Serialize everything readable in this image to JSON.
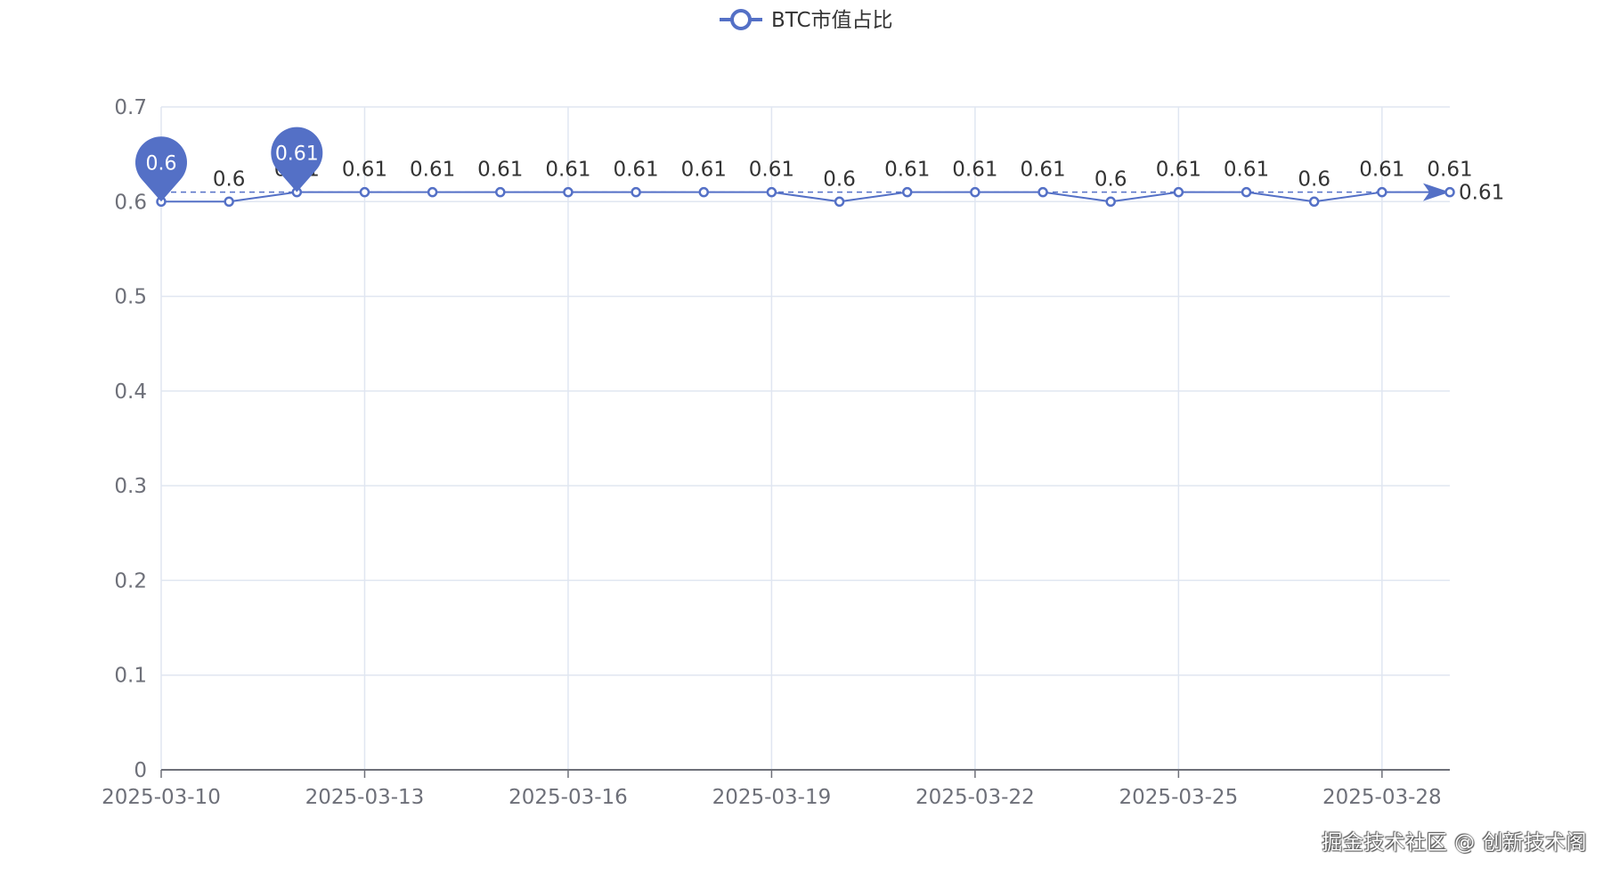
{
  "chart_data": {
    "type": "line",
    "legend": {
      "label": "BTC市值占比",
      "position": "top-center"
    },
    "x": [
      "2025-03-10",
      "2025-03-11",
      "2025-03-12",
      "2025-03-13",
      "2025-03-14",
      "2025-03-15",
      "2025-03-16",
      "2025-03-17",
      "2025-03-18",
      "2025-03-19",
      "2025-03-20",
      "2025-03-21",
      "2025-03-22",
      "2025-03-23",
      "2025-03-24",
      "2025-03-25",
      "2025-03-26",
      "2025-03-27",
      "2025-03-28",
      "2025-03-29"
    ],
    "x_tick_labels": [
      "2025-03-10",
      "2025-03-13",
      "2025-03-16",
      "2025-03-19",
      "2025-03-22",
      "2025-03-25",
      "2025-03-28"
    ],
    "series": [
      {
        "name": "BTC市值占比",
        "values": [
          0.6,
          0.6,
          0.61,
          0.61,
          0.61,
          0.61,
          0.61,
          0.61,
          0.61,
          0.61,
          0.6,
          0.61,
          0.61,
          0.61,
          0.6,
          0.61,
          0.61,
          0.6,
          0.61,
          0.61
        ],
        "labels": [
          "0.6",
          "0.6",
          "0.61",
          "0.61",
          "0.61",
          "0.61",
          "0.61",
          "0.61",
          "0.61",
          "0.61",
          "0.6",
          "0.61",
          "0.61",
          "0.61",
          "0.6",
          "0.61",
          "0.61",
          "0.6",
          "0.61",
          "0.61"
        ]
      }
    ],
    "mark_points": [
      {
        "type": "min",
        "x": "2025-03-10",
        "value": 0.6,
        "label": "0.6"
      },
      {
        "type": "max",
        "x": "2025-03-12",
        "value": 0.61,
        "label": "0.61"
      }
    ],
    "mark_line": {
      "type": "average",
      "value": 0.61,
      "label": "0.61"
    },
    "ylim": [
      0,
      0.7
    ],
    "y_ticks": [
      "0",
      "0.1",
      "0.2",
      "0.3",
      "0.4",
      "0.5",
      "0.6",
      "0.7"
    ],
    "xlabel": "",
    "ylabel": "",
    "grid": true,
    "colors": {
      "series": "#5470c6",
      "grid": "#e0e6f1",
      "axis": "#6e7079"
    }
  },
  "watermark": "掘金技术社区 @ 创新技术阁"
}
